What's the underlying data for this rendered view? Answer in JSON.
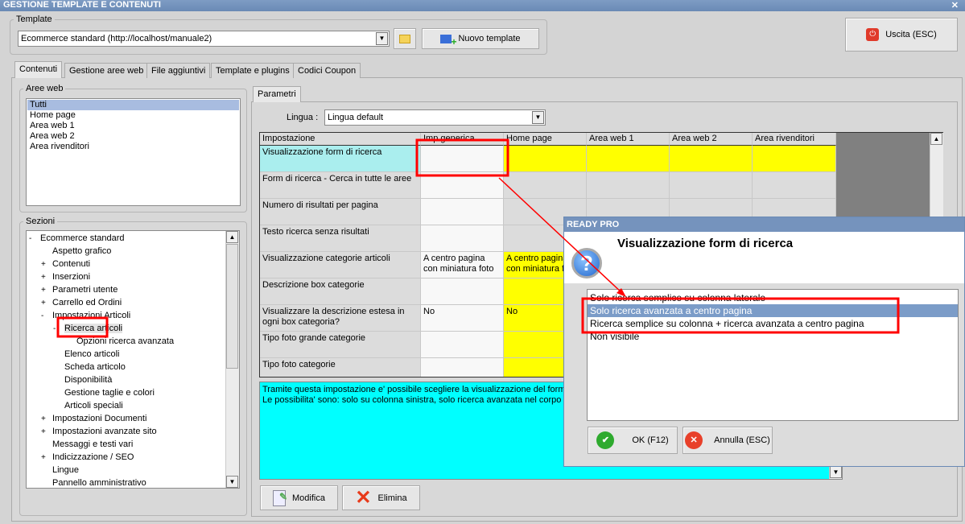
{
  "window": {
    "title": "GESTIONE TEMPLATE E CONTENUTI",
    "close": "✕"
  },
  "template": {
    "legend": "Template",
    "value": "Ecommerce standard (http://localhost/manuale2)",
    "new_label": "Nuovo template",
    "exit_label": "Uscita (ESC)"
  },
  "tabs": [
    "Contenuti",
    "Gestione aree web",
    "File aggiuntivi",
    "Template e plugins",
    "Codici Coupon"
  ],
  "aree_web": {
    "legend": "Aree web",
    "items": [
      "Tutti",
      "Home page",
      "Area web 1",
      "Area web 2",
      "Area rivenditori"
    ],
    "selected": 0
  },
  "sezioni": {
    "legend": "Sezioni",
    "items": [
      {
        "label": "Ecommerce standard",
        "level": 0,
        "exp": "-"
      },
      {
        "label": "Aspetto grafico",
        "level": 1,
        "exp": ""
      },
      {
        "label": "Contenuti",
        "level": 1,
        "exp": "+"
      },
      {
        "label": "Inserzioni",
        "level": 1,
        "exp": "+"
      },
      {
        "label": "Parametri utente",
        "level": 1,
        "exp": "+"
      },
      {
        "label": "Carrello ed Ordini",
        "level": 1,
        "exp": "+"
      },
      {
        "label": "Impostazioni Articoli",
        "level": 1,
        "exp": "-"
      },
      {
        "label": "Ricerca articoli",
        "level": 2,
        "exp": "-"
      },
      {
        "label": "Opzioni ricerca avanzata",
        "level": 3,
        "exp": ""
      },
      {
        "label": "Elenco articoli",
        "level": 2,
        "exp": ""
      },
      {
        "label": "Scheda articolo",
        "level": 2,
        "exp": ""
      },
      {
        "label": "Disponibilità",
        "level": 2,
        "exp": ""
      },
      {
        "label": "Gestione taglie e colori",
        "level": 2,
        "exp": ""
      },
      {
        "label": "Articoli speciali",
        "level": 2,
        "exp": ""
      },
      {
        "label": "Impostazioni Documenti",
        "level": 1,
        "exp": "+"
      },
      {
        "label": "Impostazioni avanzate sito",
        "level": 1,
        "exp": "+"
      },
      {
        "label": "Messaggi e testi vari",
        "level": 1,
        "exp": ""
      },
      {
        "label": "Indicizzazione / SEO",
        "level": 1,
        "exp": "+"
      },
      {
        "label": "Lingue",
        "level": 1,
        "exp": ""
      },
      {
        "label": "Pannello amministrativo",
        "level": 1,
        "exp": ""
      }
    ]
  },
  "params": {
    "tab": "Parametri",
    "lingua_label": "Lingua :",
    "lingua_value": "Lingua default",
    "columns": [
      "Impostazione",
      "Imp.generica",
      "Home page",
      "Area web 1",
      "Area web 2",
      "Area rivenditori"
    ],
    "rows": [
      {
        "name": "Visualizzazione form di ricerca",
        "values": [
          "",
          "",
          "",
          "",
          ""
        ],
        "yellow": [
          false,
          true,
          true,
          true,
          true
        ]
      },
      {
        "name": "Form di ricerca - Cerca in tutte le aree",
        "values": [
          "",
          "",
          "",
          "",
          ""
        ],
        "yellow": [
          false,
          false,
          false,
          false,
          false
        ]
      },
      {
        "name": "Numero di risultati per pagina",
        "values": [
          "",
          "",
          "",
          "",
          ""
        ],
        "yellow": [
          false,
          false,
          false,
          false,
          false
        ]
      },
      {
        "name": "Testo ricerca senza risultati",
        "values": [
          "",
          "",
          "",
          "",
          ""
        ],
        "yellow": [
          false,
          false,
          false,
          false,
          false
        ]
      },
      {
        "name": "Visualizzazione categorie articoli",
        "values": [
          "A centro pagina con miniatura foto",
          "A centro pagina con miniatura foto",
          "",
          "",
          ""
        ],
        "yellow": [
          false,
          true,
          true,
          true,
          true
        ]
      },
      {
        "name": "Descrizione box categorie",
        "values": [
          "",
          "",
          "",
          "",
          ""
        ],
        "yellow": [
          false,
          true,
          true,
          true,
          true
        ]
      },
      {
        "name": "Visualizzare la descrizione estesa in ogni box categoria?",
        "values": [
          "No",
          "No",
          "",
          "",
          ""
        ],
        "yellow": [
          false,
          true,
          true,
          true,
          true
        ]
      },
      {
        "name": "Tipo foto grande categorie",
        "values": [
          "",
          "",
          "",
          "",
          ""
        ],
        "yellow": [
          false,
          true,
          true,
          true,
          true
        ]
      },
      {
        "name": "Tipo foto categorie",
        "values": [
          "",
          "",
          "",
          "",
          ""
        ],
        "yellow": [
          false,
          true,
          true,
          true,
          true
        ]
      }
    ],
    "description": "Tramite questa impostazione e' possibile scegliere la visualizzazione del form di ricerca.\nLe possibilita' sono: solo su colonna sinistra, solo ricerca avanzata nel corpo pagina",
    "modifica": "Modifica",
    "elimina": "Elimina"
  },
  "dialog": {
    "title": "READY PRO",
    "heading": "Visualizzazione form di ricerca",
    "options": [
      "Solo ricerca semplice su colonna laterale",
      "Solo ricerca avanzata a centro pagina",
      "Ricerca semplice su colonna + ricerca avanzata a centro pagina",
      "Non visibile"
    ],
    "selected": 1,
    "ok": "OK (F12)",
    "cancel": "Annulla (ESC)"
  },
  "colors": {
    "yellow": "#ffff00",
    "cyan": "#00ffff",
    "selected_row": "#aaeeee",
    "highlight": "#ff0000",
    "title": "#6a8ab5"
  }
}
